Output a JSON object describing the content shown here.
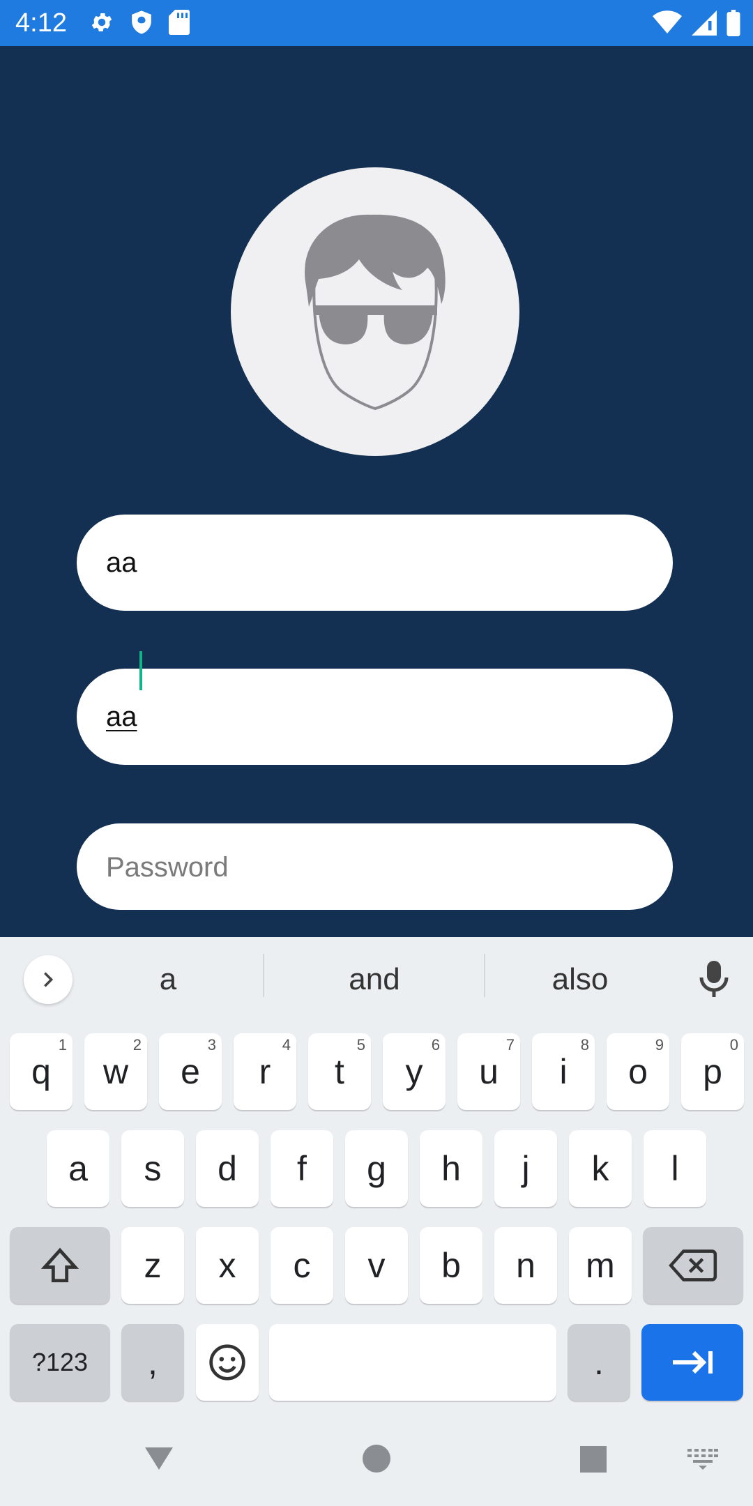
{
  "status_bar": {
    "time": "4:12",
    "left_icons": [
      "settings-gear-icon",
      "shield-icon",
      "sd-card-icon"
    ],
    "right_icons": [
      "wifi-icon",
      "cell-signal-icon",
      "battery-icon"
    ],
    "color": "#1f7be0"
  },
  "screen": {
    "background": "#132f52",
    "avatar": "person-with-sunglasses-avatar",
    "username_field": {
      "value": "aa"
    },
    "second_field": {
      "value": "aa"
    },
    "password_field": {
      "value": "",
      "placeholder": "Password"
    }
  },
  "keyboard": {
    "suggestions": [
      "a",
      "and",
      "also"
    ],
    "row1": [
      {
        "label": "q",
        "hint": "1"
      },
      {
        "label": "w",
        "hint": "2"
      },
      {
        "label": "e",
        "hint": "3"
      },
      {
        "label": "r",
        "hint": "4"
      },
      {
        "label": "t",
        "hint": "5"
      },
      {
        "label": "y",
        "hint": "6"
      },
      {
        "label": "u",
        "hint": "7"
      },
      {
        "label": "i",
        "hint": "8"
      },
      {
        "label": "o",
        "hint": "9"
      },
      {
        "label": "p",
        "hint": "0"
      }
    ],
    "row2": [
      "a",
      "s",
      "d",
      "f",
      "g",
      "h",
      "j",
      "k",
      "l"
    ],
    "row3": [
      "z",
      "x",
      "c",
      "v",
      "b",
      "n",
      "m"
    ],
    "symbols_label": "?123",
    "comma_label": ",",
    "period_label": ".",
    "enter_color": "#1a73e8"
  }
}
